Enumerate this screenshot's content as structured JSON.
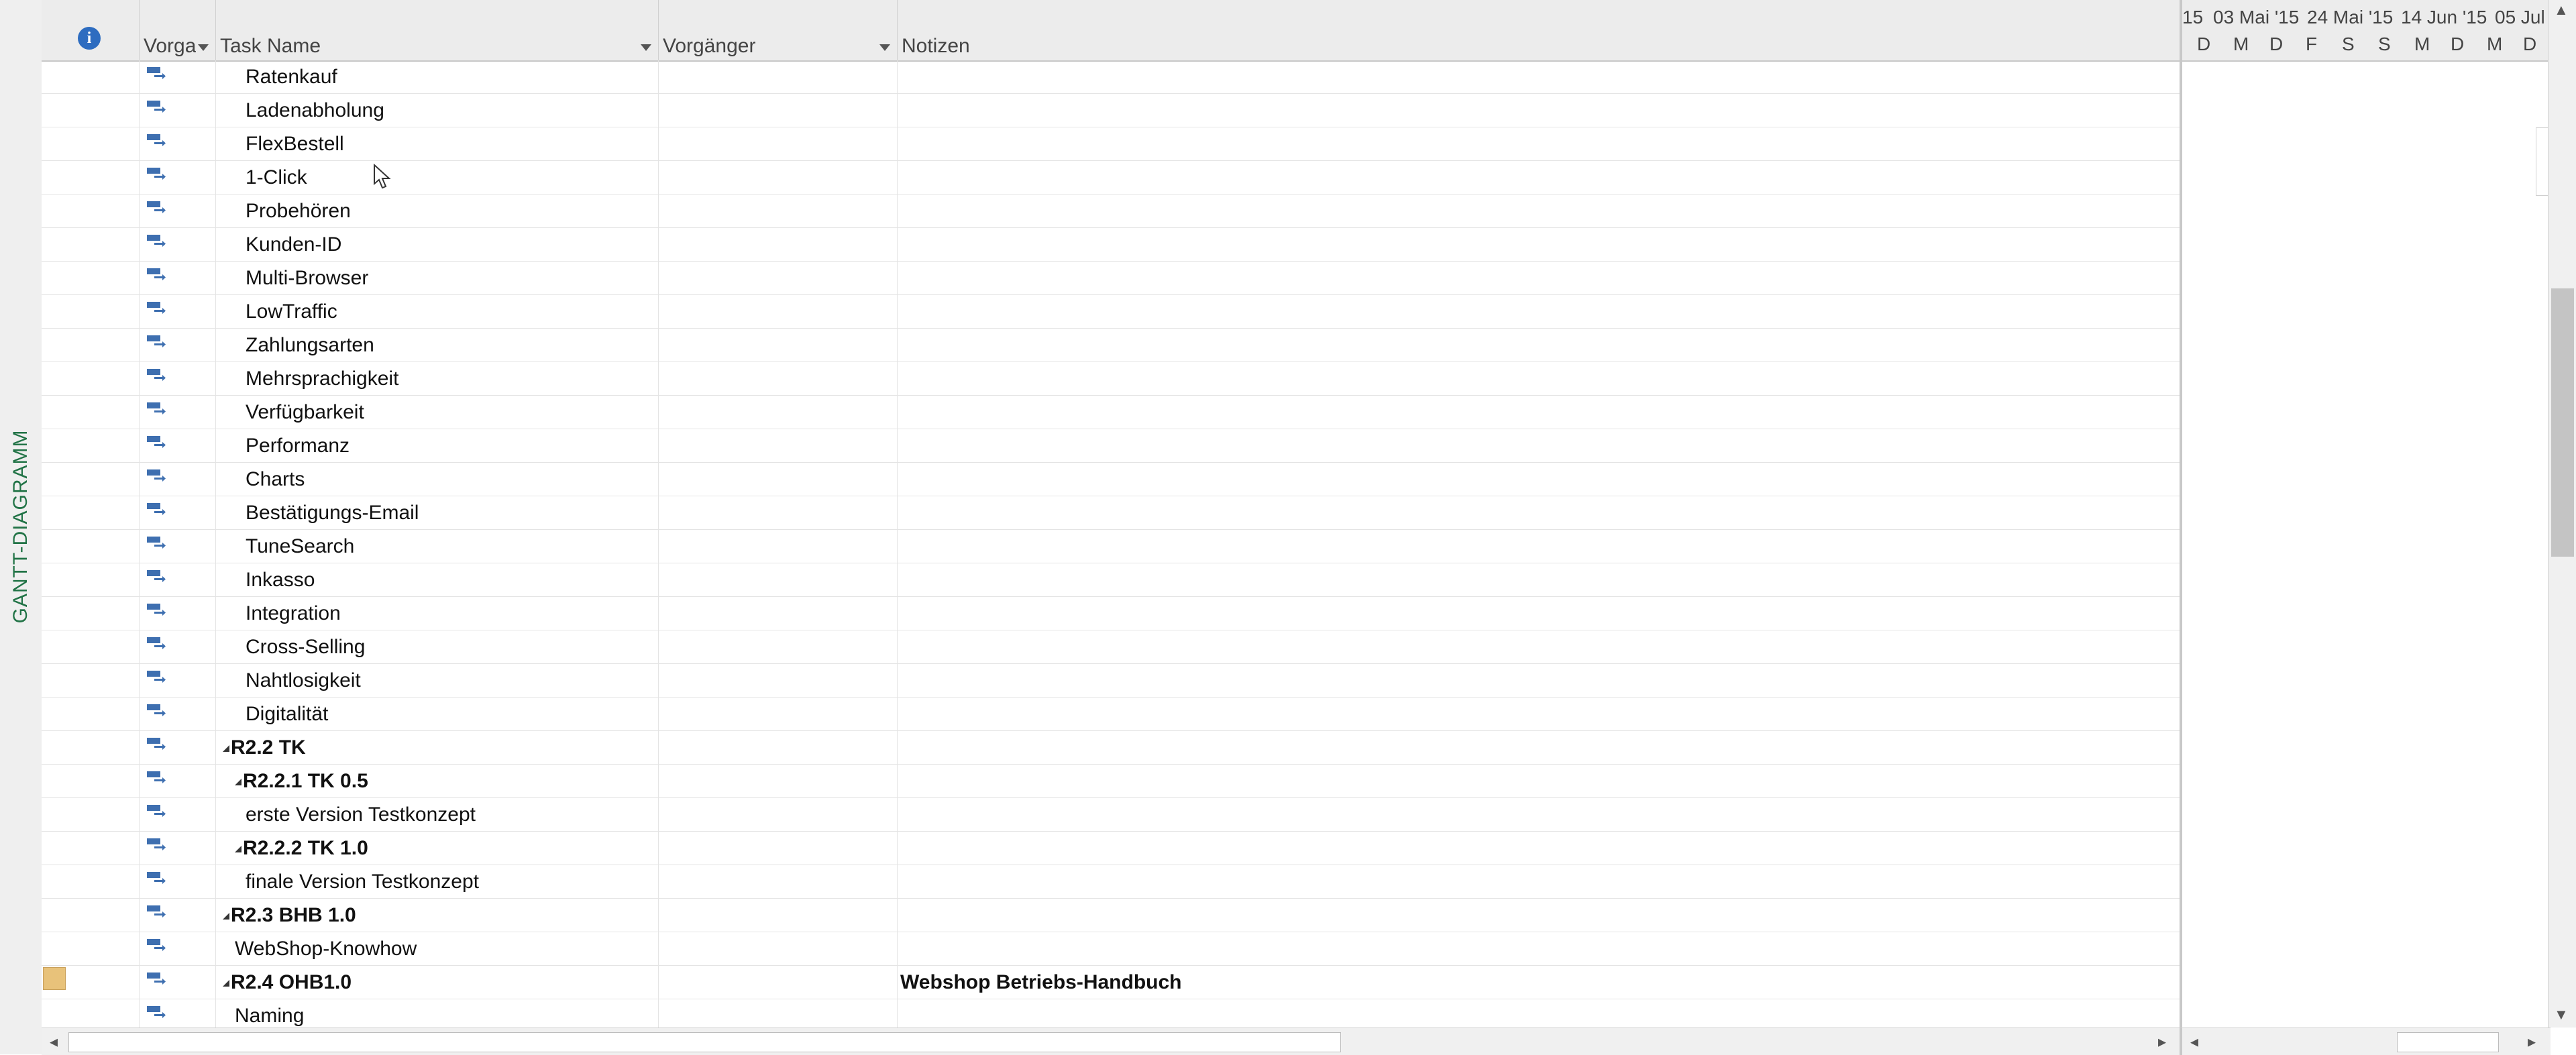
{
  "sidebar": {
    "view_label": "GANTT-DIAGRAMM"
  },
  "columns": {
    "indicators": "",
    "mode": "Vorga",
    "task_name": "Task Name",
    "predecessors": "Vorgänger",
    "notes": "Notizen"
  },
  "timescale": {
    "top": [
      "15",
      "03 Mai '15",
      "24 Mai '15",
      "14 Jun '15",
      "05 Jul"
    ],
    "bottom": [
      "D",
      "M",
      "D",
      "F",
      "S",
      "S",
      "M",
      "D",
      "M",
      "D"
    ]
  },
  "rows": [
    {
      "id": "28",
      "name": "Ratenkauf",
      "level": 3,
      "summary": false,
      "note": "",
      "has_note": false
    },
    {
      "id": "29",
      "name": "Ladenabholung",
      "level": 3,
      "summary": false,
      "note": "",
      "has_note": false
    },
    {
      "id": "30",
      "name": "FlexBestell",
      "level": 3,
      "summary": false,
      "note": "",
      "has_note": false
    },
    {
      "id": "31",
      "name": "1-Click",
      "level": 3,
      "summary": false,
      "note": "",
      "has_note": false
    },
    {
      "id": "32",
      "name": "Probehören",
      "level": 3,
      "summary": false,
      "note": "",
      "has_note": false
    },
    {
      "id": "33",
      "name": "Kunden-ID",
      "level": 3,
      "summary": false,
      "note": "",
      "has_note": false
    },
    {
      "id": "34",
      "name": "Multi-Browser",
      "level": 3,
      "summary": false,
      "note": "",
      "has_note": false
    },
    {
      "id": "35",
      "name": "LowTraffic",
      "level": 3,
      "summary": false,
      "note": "",
      "has_note": false
    },
    {
      "id": "36",
      "name": "Zahlungsarten",
      "level": 3,
      "summary": false,
      "note": "",
      "has_note": false
    },
    {
      "id": "37",
      "name": "Mehrsprachigkeit",
      "level": 3,
      "summary": false,
      "note": "",
      "has_note": false
    },
    {
      "id": "38",
      "name": "Verfügbarkeit",
      "level": 3,
      "summary": false,
      "note": "",
      "has_note": false
    },
    {
      "id": "39",
      "name": "Performanz",
      "level": 3,
      "summary": false,
      "note": "",
      "has_note": false
    },
    {
      "id": "40",
      "name": "Charts",
      "level": 3,
      "summary": false,
      "note": "",
      "has_note": false
    },
    {
      "id": "41",
      "name": "Bestätigungs-Email",
      "level": 3,
      "summary": false,
      "note": "",
      "has_note": false
    },
    {
      "id": "42",
      "name": "TuneSearch",
      "level": 3,
      "summary": false,
      "note": "",
      "has_note": false
    },
    {
      "id": "43",
      "name": "Inkasso",
      "level": 3,
      "summary": false,
      "note": "",
      "has_note": false
    },
    {
      "id": "44",
      "name": "Integration",
      "level": 3,
      "summary": false,
      "note": "",
      "has_note": false
    },
    {
      "id": "45",
      "name": "Cross-Selling",
      "level": 3,
      "summary": false,
      "note": "",
      "has_note": false
    },
    {
      "id": "46",
      "name": "Nahtlosigkeit",
      "level": 3,
      "summary": false,
      "note": "",
      "has_note": false
    },
    {
      "id": "47",
      "name": "Digitalität",
      "level": 3,
      "summary": false,
      "note": "",
      "has_note": false
    },
    {
      "id": "48",
      "name": "R2.2 TK",
      "level": 1,
      "summary": true,
      "note": "",
      "has_note": false
    },
    {
      "id": "49",
      "name": "R2.2.1 TK 0.5",
      "level": 2,
      "summary": true,
      "note": "",
      "has_note": false
    },
    {
      "id": "50",
      "name": "erste Version Testkonzept",
      "level": 3,
      "summary": false,
      "note": "",
      "has_note": false
    },
    {
      "id": "51",
      "name": "R2.2.2 TK 1.0",
      "level": 2,
      "summary": true,
      "note": "",
      "has_note": false
    },
    {
      "id": "52",
      "name": "finale Version Testkonzept",
      "level": 3,
      "summary": false,
      "note": "",
      "has_note": false
    },
    {
      "id": "53",
      "name": "R2.3 BHB 1.0",
      "level": 1,
      "summary": true,
      "note": "",
      "has_note": false
    },
    {
      "id": "54",
      "name": "WebShop-Knowhow",
      "level": 2,
      "summary": false,
      "note": "",
      "has_note": false
    },
    {
      "id": "55",
      "name": "R2.4 OHB1.0",
      "level": 1,
      "summary": true,
      "note": "Webshop Betriebs-Handbuch",
      "has_note": true
    },
    {
      "id": "56",
      "name": "Naming",
      "level": 2,
      "summary": false,
      "note": "",
      "has_note": false
    }
  ],
  "colors": {
    "accent_green": "#217346",
    "info_blue": "#2d6cc0",
    "note_yellow": "#e8c27a"
  }
}
